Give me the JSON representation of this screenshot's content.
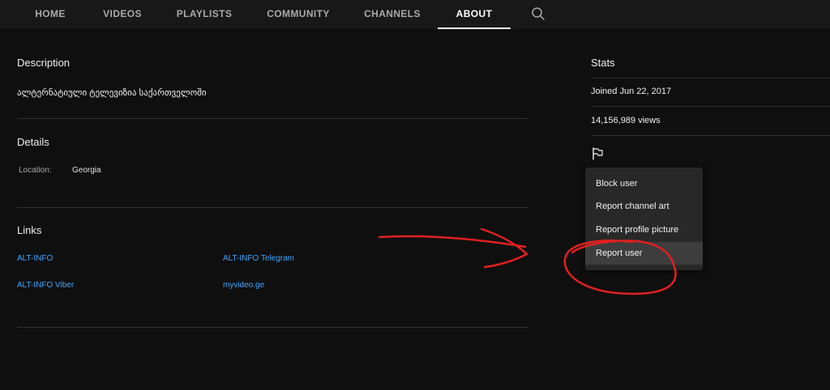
{
  "tabs": [
    {
      "label": "HOME"
    },
    {
      "label": "VIDEOS"
    },
    {
      "label": "PLAYLISTS"
    },
    {
      "label": "COMMUNITY"
    },
    {
      "label": "CHANNELS"
    },
    {
      "label": "ABOUT"
    }
  ],
  "active_tab": "ABOUT",
  "description": {
    "title": "Description",
    "text": "ალტერნატიული ტელევიზია საქართველოში"
  },
  "details": {
    "title": "Details",
    "location_label": "Location:",
    "location_value": "Georgia"
  },
  "links": {
    "title": "Links",
    "items": [
      {
        "label": "ALT-INFO"
      },
      {
        "label": "ALT-INFO Telegram"
      },
      {
        "label": "ALT-INFO Viber"
      },
      {
        "label": "myvideo.ge"
      }
    ]
  },
  "stats": {
    "title": "Stats",
    "joined": "Joined Jun 22, 2017",
    "views": "14,156,989 views"
  },
  "menu": {
    "items": [
      {
        "label": "Block user"
      },
      {
        "label": "Report channel art"
      },
      {
        "label": "Report profile picture"
      },
      {
        "label": "Report user"
      }
    ],
    "highlighted": "Report user"
  },
  "colors": {
    "background": "#0f0f0f",
    "tabbar": "#181818",
    "link": "#3ea6ff",
    "menu": "#282828",
    "annotation": "#e02020"
  },
  "icons": {
    "search": "search-icon",
    "flag": "flag-icon"
  }
}
